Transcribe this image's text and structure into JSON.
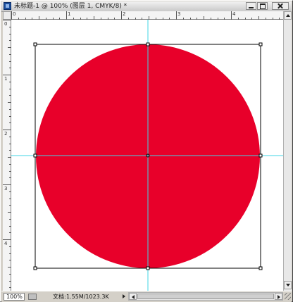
{
  "window": {
    "title": "未标题-1 @ 100% (图层 1, CMYK/8) *",
    "minimize_label": "minimize",
    "maximize_label": "maximize",
    "close_label": "close"
  },
  "ruler": {
    "horizontal_labels": [
      "0",
      "1",
      "2",
      "3",
      "4"
    ],
    "vertical_labels": [
      "0",
      "1",
      "2",
      "3",
      "4"
    ]
  },
  "canvas": {
    "shape": "circle",
    "fill_color": "#e8002a",
    "guide_color": "#3fd6e6",
    "selection_color": "#000000"
  },
  "status": {
    "zoom": "100%",
    "doc_label": "文档:",
    "doc_value": "1.55M/1023.3K"
  }
}
